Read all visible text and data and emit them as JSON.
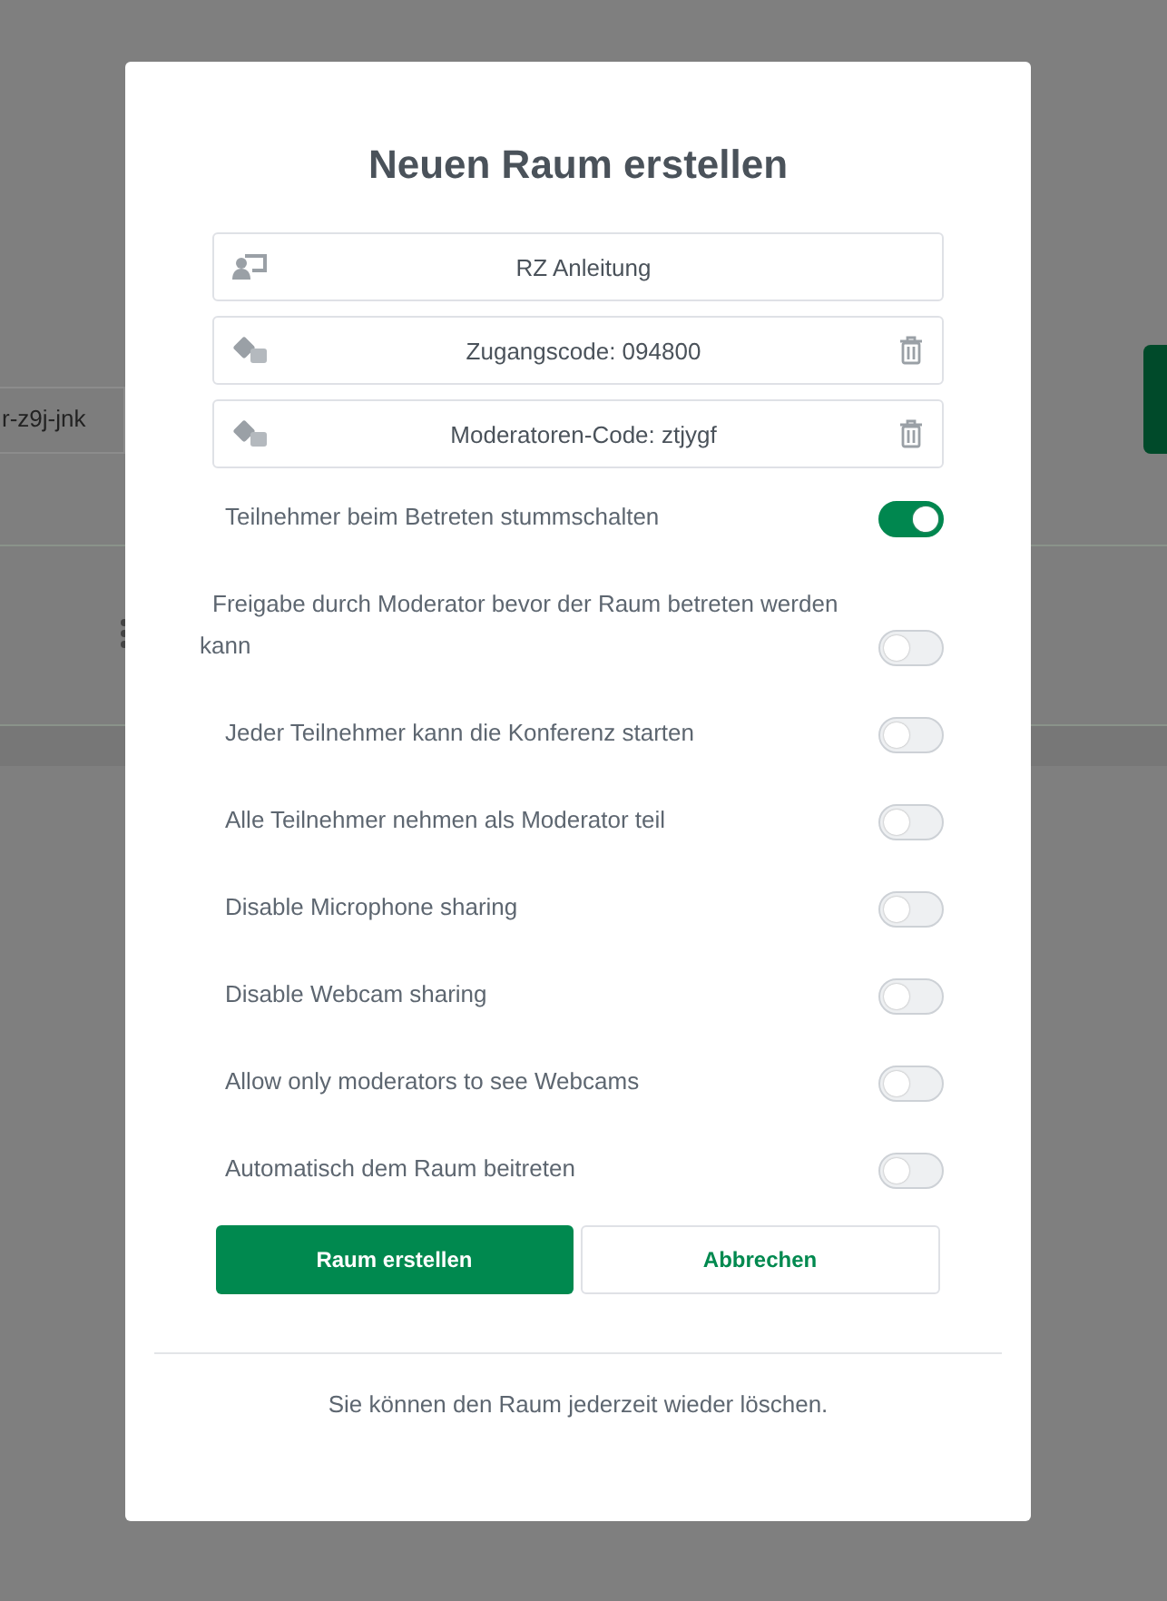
{
  "background": {
    "field_value": "r-z9j-jnk"
  },
  "dialog": {
    "title": "Neuen Raum erstellen",
    "fields": [
      {
        "kind": "room",
        "value": "RZ Anleitung",
        "deletable": false
      },
      {
        "kind": "code",
        "value": "Zugangscode: 094800",
        "deletable": true
      },
      {
        "kind": "code",
        "value": "Moderatoren-Code: ztjygf",
        "deletable": true
      }
    ],
    "options": [
      {
        "label": "Teilnehmer beim Betreten stummschalten",
        "on": true
      },
      {
        "label": "Freigabe durch Moderator bevor der Raum betreten werden kann",
        "on": false
      },
      {
        "label": "Jeder Teilnehmer kann die Konferenz starten",
        "on": false
      },
      {
        "label": "Alle Teilnehmer nehmen als Moderator teil",
        "on": false
      },
      {
        "label": "Disable Microphone sharing",
        "on": false
      },
      {
        "label": "Disable Webcam sharing",
        "on": false
      },
      {
        "label": "Allow only moderators to see Webcams",
        "on": false
      },
      {
        "label": "Automatisch dem Raum beitreten",
        "on": false
      }
    ],
    "buttons": [
      {
        "label": "Raum erstellen",
        "kind": "primary"
      },
      {
        "label": "Abbrechen",
        "kind": "secondary"
      }
    ],
    "footer": "Sie können den Raum jederzeit wieder löschen."
  }
}
